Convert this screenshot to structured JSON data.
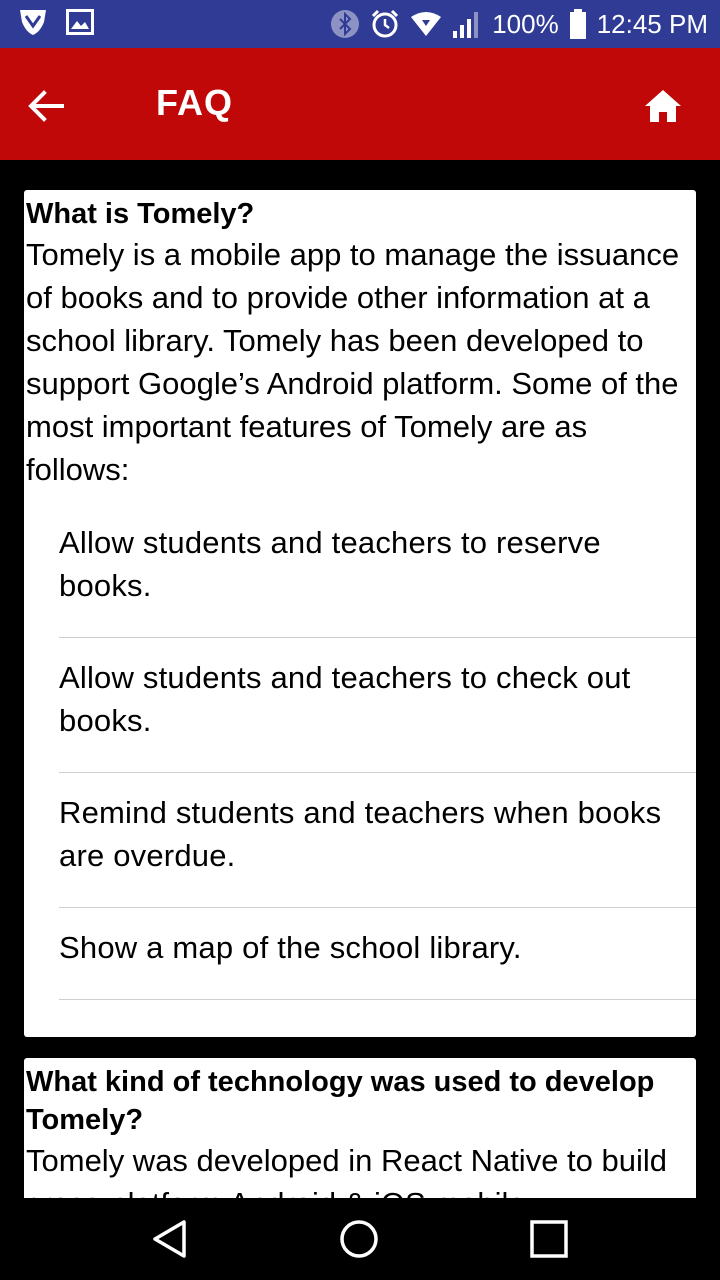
{
  "status_bar": {
    "battery": "100%",
    "time": "12:45 PM",
    "icons": [
      "shield-icon",
      "image-icon",
      "bluetooth-icon",
      "alarm-icon",
      "wifi-icon",
      "signal-icon",
      "battery-icon"
    ]
  },
  "header": {
    "title": "FAQ",
    "back_icon": "arrow-left-icon",
    "home_icon": "home-icon",
    "background": "#c00808"
  },
  "faq": [
    {
      "question": "What is Tomely?",
      "answer": "Tomely is a mobile app to manage the issuance of books and to provide other information at a school library. Tomely has been developed to support Google’s Android platform. Some of the most important features of Tomely are as follows:",
      "features": [
        "Allow students and teachers to reserve books.",
        "Allow students and teachers to check out books.",
        "Remind students and teachers when books are overdue.",
        "Show a map of the school library."
      ]
    },
    {
      "question": "What kind of technology was used to develop Tomely?",
      "answer": "Tomely was developed in React Native to build cross-platform Android & iOS mobile"
    }
  ],
  "nav_bar": {
    "icons": [
      "back-triangle-icon",
      "home-circle-icon",
      "recents-square-icon"
    ]
  }
}
